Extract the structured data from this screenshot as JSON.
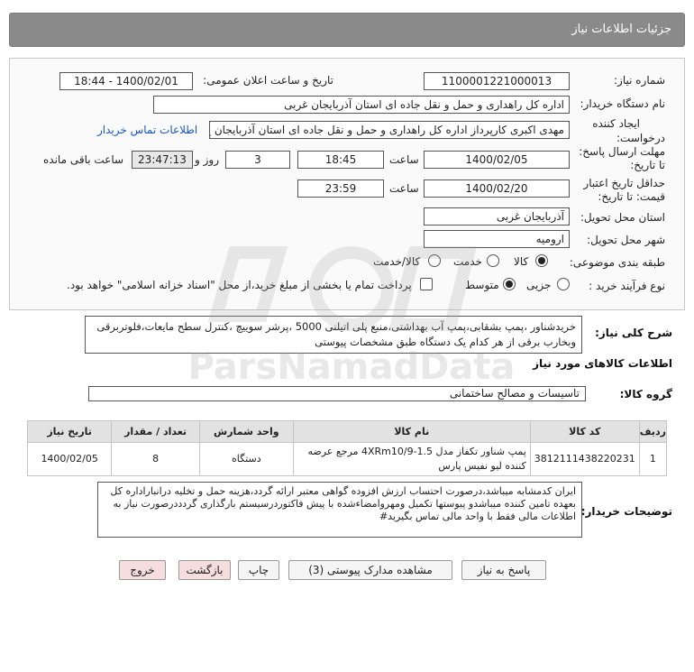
{
  "header": {
    "title": "جزئیات اطلاعات نیاز"
  },
  "fields": {
    "need_number_label": "شماره نیاز:",
    "need_number": "1100001221000013",
    "announce_label": "تاریخ و ساعت اعلان عمومی:",
    "announce_value": "1400/02/01 - 18:44",
    "buyer_label": "نام دستگاه خریدار:",
    "buyer_value": "اداره کل راهداری و حمل و نقل جاده ای استان آذربایجان غربی",
    "creator_label": "ایجاد کننده درخواست:",
    "creator_value": "مهدی اکبری کارپرداز اداره کل راهداری و حمل و نقل جاده ای استان آذربایجان غ",
    "contact_link": "اطلاعات تماس خریدار",
    "reply_deadline_label": "مهلت ارسال پاسخ: تا تاریخ:",
    "reply_date": "1400/02/05",
    "time_label": "ساعت",
    "reply_time": "18:45",
    "days_value": "3",
    "days_label": "روز و",
    "remaining_value": "23:47:13",
    "remaining_label": "ساعت باقی مانده",
    "price_deadline_label": "حداقل تاریخ اعتبار قیمت: تا تاریخ:",
    "price_date": "1400/02/20",
    "price_time": "23:59",
    "province_label": "استان محل تحویل:",
    "province_value": "آذربایجان غربی",
    "city_label": "شهر محل تحویل:",
    "city_value": "ارومیه",
    "category_label": "طبقه بندی موضوعی:",
    "category_options": [
      "کالا",
      "خدمت",
      "کالا/خدمت"
    ],
    "process_label": "نوع فرآیند خرید :",
    "process_options": [
      "جزیی",
      "متوسط"
    ],
    "payment_note": "پرداخت تمام یا بخشی از مبلغ خرید،از محل \"اسناد خزانه اسلامی\" خواهد بود."
  },
  "summary": {
    "label": "شرح کلی نیاز:",
    "text": "خریدشناور ،پمپ بشقابی،پمپ آب بهداشتی،منبع پلی اتیلنی 5000 ،پرشر سوییچ ،کنترل سطح مایعات،فلوتربرقی وبخارب برقی از هر کدام یک دستگاه طبق مشخصات پیوستی"
  },
  "goods": {
    "section_title": "اطلاعات کالاهای مورد نیاز",
    "group_label": "گروه کالا:",
    "group_value": "تاسیسات و مصالح ساختمانی",
    "columns": [
      "ردیف",
      "کد کالا",
      "نام کالا",
      "واحد شمارش",
      "تعداد / مقدار",
      "تاریخ نیاز"
    ],
    "rows": [
      {
        "row": "1",
        "code": "3812111438220231",
        "name": "پمپ شناور تکفاز مدل 4XRm10/9-1.5 مرجع عرضه کننده لیو نفیس پارس",
        "unit": "دستگاه",
        "qty": "8",
        "date": "1400/02/05"
      }
    ]
  },
  "buyer_notes": {
    "label": "توضیحات خریدار:",
    "text": "ایران کدمشابه میباشد،درصورت احتساب ارزش افزوده گواهی معتبر ارائه گردد،هزینه حمل و تخلیه درانباراداره کل بعهده تامین کننده میباشدو پیوستها تکمیل ومهروامضاءشده با پیش فاکتوردرسیستم بارگذاری گردددرصورت نیاز به اطلاعات مالی فقط با واحد مالی تماس بگیرید#"
  },
  "buttons": {
    "reply": "پاسخ به نیاز",
    "attachments": "مشاهده مدارک پیوستی (3)",
    "print": "چاپ",
    "back": "بازگشت",
    "exit": "خروج"
  },
  "colors": {
    "titlebar": "#8a8a8a",
    "link": "#1a56c4",
    "back_button": "#f6dede",
    "exit_button": "#f6dede"
  }
}
